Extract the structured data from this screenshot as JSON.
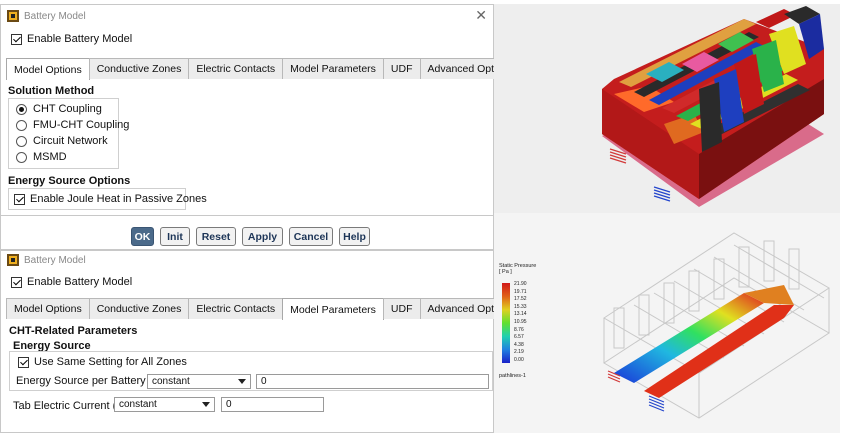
{
  "dialog1": {
    "title": "Battery Model",
    "enable_label": "Enable Battery Model",
    "tabs": [
      "Model Options",
      "Conductive Zones",
      "Electric Contacts",
      "Model Parameters",
      "UDF",
      "Advanced Options"
    ],
    "solution_method_label": "Solution Method",
    "methods": [
      "CHT Coupling",
      "FMU-CHT Coupling",
      "Circuit Network",
      "MSMD"
    ],
    "selected_method": "CHT Coupling",
    "energy_source_options_label": "Energy Source Options",
    "joule_heat_label": "Enable Joule Heat in Passive Zones",
    "buttons": [
      "OK",
      "Init",
      "Reset",
      "Apply",
      "Cancel",
      "Help"
    ]
  },
  "dialog2": {
    "title": "Battery Model",
    "enable_label": "Enable Battery Model",
    "tabs": [
      "Model Options",
      "Conductive Zones",
      "Electric Contacts",
      "Model Parameters",
      "UDF",
      "Advanced Options"
    ],
    "cht_params_label": "CHT-Related Parameters",
    "energy_source_label": "Energy Source",
    "same_setting_label": "Use Same Setting for All Zones",
    "energy_per_battery_label": "Energy Source per Battery (W)",
    "energy_per_battery_mode": "constant",
    "energy_per_battery_value": "0",
    "tab_current_label": "Tab Electric Current (A)",
    "tab_current_mode": "constant",
    "tab_current_value": "0"
  },
  "legend": {
    "title_line1": "Static Pressure",
    "title_line2": "[ Pa ]",
    "values": [
      "21.90",
      "19.71",
      "17.52",
      "15.33",
      "13.14",
      "10.95",
      "8.76",
      "6.57",
      "4.38",
      "2.19",
      "0.00"
    ],
    "footer": "pathlines-1"
  },
  "colors": {
    "primary_button": "#4b6a8a",
    "border": "#b8b8b8"
  }
}
